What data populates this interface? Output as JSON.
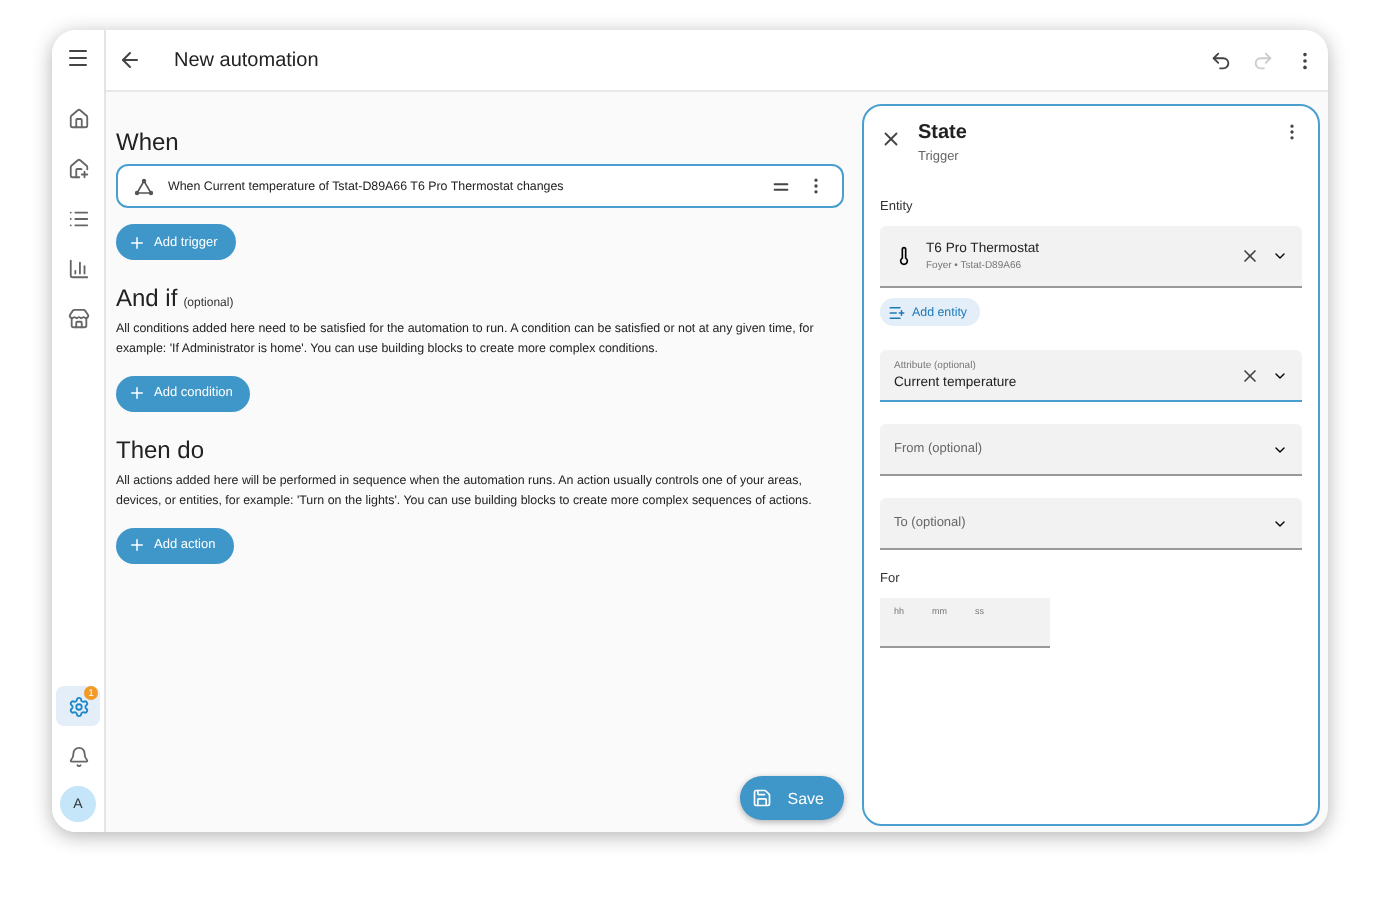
{
  "header": {
    "title": "New automation"
  },
  "sidebar": {
    "items": [
      {
        "kind": "home",
        "selected": false
      },
      {
        "kind": "home-edit",
        "selected": false
      },
      {
        "kind": "list",
        "selected": false
      },
      {
        "kind": "chart",
        "selected": false
      },
      {
        "kind": "store",
        "selected": false
      }
    ],
    "bottom": [
      {
        "kind": "settings",
        "selected": true,
        "badge": "1"
      },
      {
        "kind": "bell",
        "selected": false
      },
      {
        "kind": "avatar",
        "selected": false,
        "initial": "A"
      }
    ]
  },
  "sections": [
    {
      "title": "When",
      "trigger": "When Current temperature of Tstat-D89A66 T6 Pro Thermostat changes",
      "button": "Add trigger"
    },
    {
      "title": "And if",
      "note": "(optional)",
      "description": "All conditions added here need to be satisfied for the automation to run. A condition can be satisfied or not at any given time, for example: 'If Administrator is home'. You can use building blocks to create more complex conditions.",
      "button": "Add condition"
    },
    {
      "title": "Then do",
      "description": "All actions added here will be performed in sequence when the automation runs. An action usually controls one of your areas, devices, or entities, for example: 'Turn on the lights'. You can use building blocks to create more complex sequences of actions.",
      "button": "Add action"
    }
  ],
  "save": "Save",
  "panel": {
    "title": "State",
    "subtitle": "Trigger",
    "entity_label": "Entity",
    "entity": {
      "name": "T6 Pro Thermostat",
      "detail": "Foyer • Tstat-D89A66"
    },
    "add_entity": "Add entity",
    "attribute": {
      "label": "Attribute (optional)",
      "value": "Current temperature"
    },
    "from": {
      "placeholder": "From (optional)"
    },
    "to": {
      "placeholder": "To (optional)"
    },
    "for": {
      "label": "For",
      "parts": [
        "hh",
        "mm",
        "ss"
      ]
    }
  }
}
